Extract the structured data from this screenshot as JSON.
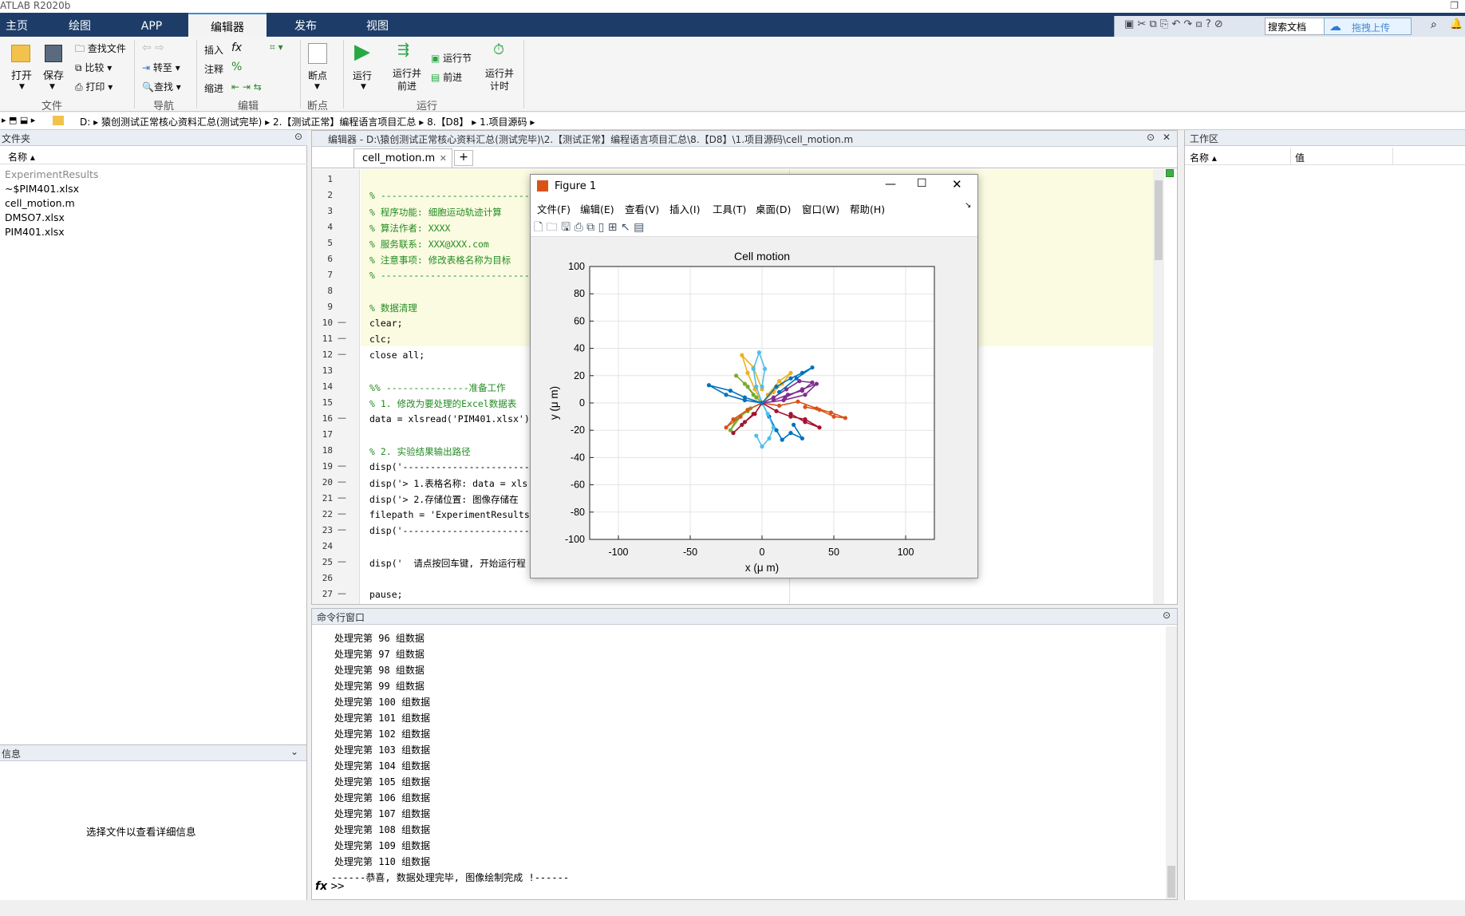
{
  "app": {
    "title": "ATLAB R2020b"
  },
  "tabs": [
    {
      "label": "主页"
    },
    {
      "label": "绘图"
    },
    {
      "label": "APP"
    },
    {
      "label": "编辑器"
    },
    {
      "label": "发布"
    },
    {
      "label": "视图"
    }
  ],
  "search": {
    "placeholder": "搜索文档",
    "upload_label": "拖拽上传"
  },
  "ribbon": {
    "open": "打开",
    "save": "保存",
    "find_files": "查找文件",
    "compare": "比较",
    "print": "打印",
    "navigate_to": "转至",
    "find": "查找",
    "insert": "插入",
    "comment": "注释",
    "indent": "缩进",
    "fx": "fx",
    "percent": "%",
    "breakpoints": "断点",
    "run": "运行",
    "run_advance": [
      "运行并",
      "前进"
    ],
    "run_section": "运行节",
    "advance": "前进",
    "run_time": [
      "运行并",
      "计时"
    ],
    "groups": {
      "file": "文件",
      "navigate": "导航",
      "edit": "编辑",
      "breakpoints": "断点",
      "run": "运行"
    }
  },
  "address": {
    "drive": "D:",
    "crumbs": [
      "猿创测试正常核心资料汇总(测试完毕)",
      "2.【测试正常】编程语言项目汇总",
      "8.【D8】",
      "1.项目源码"
    ]
  },
  "file_browser": {
    "title": "文件夹",
    "col_name": "名称",
    "items": [
      "ExperimentResults",
      "~$PIM401.xlsx",
      "cell_motion.m",
      "DMSO7.xlsx",
      "PIM401.xlsx"
    ]
  },
  "details": {
    "title": "信息",
    "hint": "选择文件以查看详细信息"
  },
  "editor": {
    "title": "编辑器 - D:\\猿创测试正常核心资料汇总(测试完毕)\\2.【测试正常】编程语言项目汇总\\8.【D8】\\1.项目源码\\cell_motion.m",
    "tab": "cell_motion.m",
    "lines": [
      {
        "n": "1",
        "dash": "",
        "text": "",
        "cls": ""
      },
      {
        "n": "2",
        "dash": "",
        "text": "% -------------------------------",
        "cls": "cmt"
      },
      {
        "n": "3",
        "dash": "",
        "text": "% 程序功能: 细胞运动轨迹计算",
        "cls": "cmt"
      },
      {
        "n": "4",
        "dash": "",
        "text": "% 算法作者: XXXX",
        "cls": "cmt"
      },
      {
        "n": "5",
        "dash": "",
        "text": "% 服务联系: XXX@XXX.com",
        "cls": "cmt"
      },
      {
        "n": "6",
        "dash": "",
        "text": "% 注意事项: 修改表格名称为目标",
        "cls": "cmt"
      },
      {
        "n": "7",
        "dash": "",
        "text": "% -------------------------------",
        "cls": "cmt"
      },
      {
        "n": "8",
        "dash": "",
        "text": "",
        "cls": ""
      },
      {
        "n": "9",
        "dash": "",
        "text": "% 数据清理",
        "cls": "cmt"
      },
      {
        "n": "10",
        "dash": "—",
        "text": "clear;",
        "cls": ""
      },
      {
        "n": "11",
        "dash": "—",
        "text": "clc;",
        "cls": ""
      },
      {
        "n": "12",
        "dash": "—",
        "text": "close all;",
        "cls": ""
      },
      {
        "n": "13",
        "dash": "",
        "text": "",
        "cls": ""
      },
      {
        "n": "14",
        "dash": "",
        "text": "%% ---------------准备工作",
        "cls": "cmt"
      },
      {
        "n": "15",
        "dash": "",
        "text": "% 1. 修改为要处理的Excel数据表",
        "cls": "cmt"
      },
      {
        "n": "16",
        "dash": "—",
        "text": "data = xlsread('PIM401.xlsx')",
        "cls": ""
      },
      {
        "n": "17",
        "dash": "",
        "text": "",
        "cls": ""
      },
      {
        "n": "18",
        "dash": "",
        "text": "% 2. 实验结果输出路径",
        "cls": "cmt"
      },
      {
        "n": "19",
        "dash": "—",
        "text": "disp('-----------------------",
        "cls": ""
      },
      {
        "n": "20",
        "dash": "—",
        "text": "disp('> 1.表格名称: data = xls",
        "cls": ""
      },
      {
        "n": "21",
        "dash": "—",
        "text": "disp('> 2.存储位置: 图像存储在",
        "cls": ""
      },
      {
        "n": "22",
        "dash": "—",
        "text": "filepath = 'ExperimentResults",
        "cls": ""
      },
      {
        "n": "23",
        "dash": "—",
        "text": "disp('-----------------------",
        "cls": ""
      },
      {
        "n": "24",
        "dash": "",
        "text": "",
        "cls": ""
      },
      {
        "n": "25",
        "dash": "—",
        "text": "disp('  请点按回车键, 开始运行程",
        "cls": ""
      },
      {
        "n": "26",
        "dash": "",
        "text": "",
        "cls": ""
      },
      {
        "n": "27",
        "dash": "—",
        "text": "pause;",
        "cls": ""
      }
    ]
  },
  "command_window": {
    "title": "命令行窗口",
    "lines": [
      "处理完第 96 组数据",
      "处理完第 97 组数据",
      "处理完第 98 组数据",
      "处理完第 99 组数据",
      "处理完第 100 组数据",
      "处理完第 101 组数据",
      "处理完第 102 组数据",
      "处理完第 103 组数据",
      "处理完第 104 组数据",
      "处理完第 105 组数据",
      "处理完第 106 组数据",
      "处理完第 107 组数据",
      "处理完第 108 组数据",
      "处理完第 109 组数据",
      "处理完第 110 组数据",
      "------恭喜, 数据处理完毕, 图像绘制完成 !------"
    ],
    "prompt": "fx >>"
  },
  "workspace": {
    "title": "工作区",
    "col_name": "名称",
    "col_value": "值"
  },
  "figure": {
    "title": "Figure 1",
    "menu": [
      "文件(F)",
      "编辑(E)",
      "查看(V)",
      "插入(I)",
      "工具(T)",
      "桌面(D)",
      "窗口(W)",
      "帮助(H)"
    ]
  },
  "chart_data": {
    "type": "line",
    "title": "Cell motion",
    "xlabel": "x (μ m)",
    "ylabel": "y (μ m)",
    "xlim": [
      -120,
      120
    ],
    "ylim": [
      -100,
      100
    ],
    "xticks": [
      -100,
      -50,
      0,
      50,
      100
    ],
    "yticks": [
      -100,
      -80,
      -60,
      -40,
      -20,
      0,
      20,
      40,
      60,
      80,
      100
    ],
    "grid": true,
    "series": [
      {
        "color": "#0072bd",
        "x": [
          0,
          -12,
          -22,
          -37,
          -25,
          -12,
          0
        ],
        "y": [
          0,
          4,
          9,
          13,
          6,
          2,
          0
        ]
      },
      {
        "color": "#d95319",
        "x": [
          0,
          12,
          25,
          38,
          48,
          58,
          50,
          40,
          30
        ],
        "y": [
          0,
          -2,
          1,
          -4,
          -7,
          -11,
          -10,
          -5,
          -3
        ]
      },
      {
        "color": "#edb120",
        "x": [
          0,
          -5,
          -10,
          -14,
          -6,
          0
        ],
        "y": [
          0,
          10,
          22,
          35,
          26,
          10
        ]
      },
      {
        "color": "#7e2f8e",
        "x": [
          0,
          8,
          17,
          26,
          35,
          28,
          18,
          8
        ],
        "y": [
          0,
          4,
          10,
          16,
          15,
          9,
          6,
          2
        ]
      },
      {
        "color": "#77ac30",
        "x": [
          0,
          -8,
          -15,
          -22,
          -18,
          -10
        ],
        "y": [
          0,
          -4,
          -10,
          -20,
          -12,
          -6
        ]
      },
      {
        "color": "#4dbeee",
        "x": [
          0,
          -4,
          -6,
          -2,
          2,
          0
        ],
        "y": [
          0,
          12,
          25,
          37,
          25,
          12
        ]
      },
      {
        "color": "#a2142f",
        "x": [
          0,
          10,
          20,
          30,
          40,
          30,
          20
        ],
        "y": [
          0,
          -6,
          -10,
          -12,
          -18,
          -14,
          -8
        ]
      },
      {
        "color": "#0072bd",
        "x": [
          0,
          5,
          10,
          14,
          20,
          28,
          22
        ],
        "y": [
          0,
          -10,
          -20,
          -27,
          -22,
          -26,
          -16
        ]
      },
      {
        "color": "#d95319",
        "x": [
          0,
          -10,
          -20,
          -25,
          -15
        ],
        "y": [
          0,
          -5,
          -12,
          -18,
          -10
        ]
      },
      {
        "color": "#edb120",
        "x": [
          0,
          8,
          14,
          20,
          12,
          4
        ],
        "y": [
          0,
          8,
          14,
          22,
          16,
          6
        ]
      },
      {
        "color": "#7e2f8e",
        "x": [
          0,
          15,
          30,
          38,
          28,
          16
        ],
        "y": [
          0,
          2,
          6,
          14,
          10,
          4
        ]
      },
      {
        "color": "#77ac30",
        "x": [
          0,
          -6,
          -12,
          -18,
          -10,
          -4
        ],
        "y": [
          0,
          6,
          14,
          20,
          12,
          4
        ]
      },
      {
        "color": "#4dbeee",
        "x": [
          0,
          4,
          8,
          5,
          0,
          -4
        ],
        "y": [
          0,
          -8,
          -18,
          -26,
          -32,
          -24
        ]
      },
      {
        "color": "#a2142f",
        "x": [
          0,
          -5,
          -12,
          -20,
          -14,
          -6
        ],
        "y": [
          0,
          -8,
          -14,
          -22,
          -16,
          -8
        ]
      },
      {
        "color": "#0072bd",
        "x": [
          0,
          10,
          20,
          28,
          35,
          24,
          12
        ],
        "y": [
          0,
          12,
          18,
          22,
          26,
          18,
          8
        ]
      }
    ]
  }
}
